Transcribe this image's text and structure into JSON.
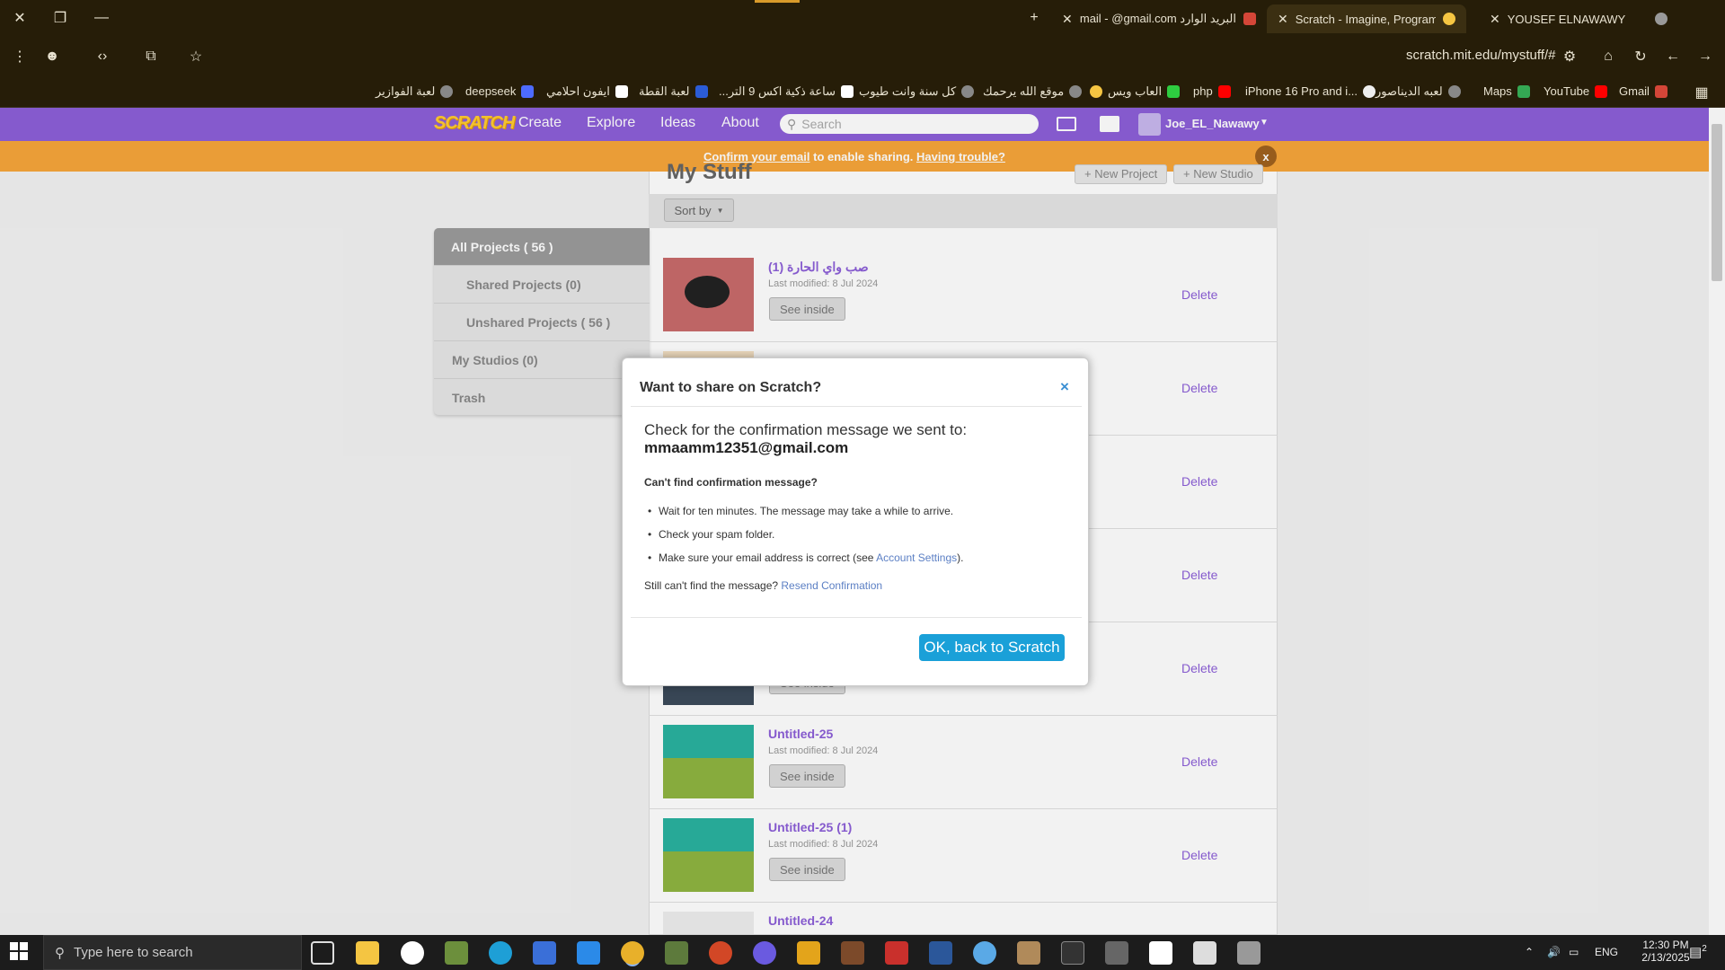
{
  "browser": {
    "tabs": [
      {
        "label": "البريد الوارد Gmail - @gmail.com",
        "favicon": "gmail-icon"
      },
      {
        "label": "Scratch - Imagine, Program, Sh",
        "favicon": "scratch-icon",
        "active": true
      },
      {
        "label": "YOUSEF ELNAWAWY",
        "favicon": "globe-icon"
      }
    ],
    "url": "scratch.mit.edu/mystuff/#",
    "bookmarks": [
      "Gmail",
      "YouTube",
      "Maps",
      "لعبه الديناصور",
      "iPhone 16 Pro and i...",
      "php",
      "العاب ويس",
      "موقع الله يرحمك",
      "كل سنة وانت طيوب",
      "ساعة ذكية اكس 9 التر...",
      "لعبة القطة",
      "ايفون احلامي",
      "deepseek",
      "لعبة الفوازير"
    ]
  },
  "scratch_nav": {
    "logo": "SCRATCH",
    "links": [
      "Create",
      "Explore",
      "Ideas",
      "About"
    ],
    "search_placeholder": "Search",
    "username": "Joe_EL_Nawawy"
  },
  "banner": {
    "link1": "Confirm your email",
    "middle": " to enable sharing. ",
    "link2": "Having trouble?",
    "close": "x"
  },
  "page": {
    "title": "My Stuff",
    "new_project": "+ New Project",
    "new_studio": "+ New Studio",
    "sort_by": "Sort by"
  },
  "sidebar": [
    {
      "label": "All Projects ( 56 )"
    },
    {
      "label": "Shared Projects (0)"
    },
    {
      "label": "Unshared Projects ( 56 )"
    },
    {
      "label": "My Studios (0)"
    },
    {
      "label": "Trash"
    }
  ],
  "projects": [
    {
      "title": "صب واي الحارة (1)",
      "modified": "Last modified: 8 Jul 2024",
      "see_inside": "See inside",
      "delete": "Delete"
    },
    {
      "title": "",
      "modified": "",
      "see_inside": "",
      "delete": "Delete"
    },
    {
      "title": "",
      "modified": "",
      "see_inside": "",
      "delete": "Delete"
    },
    {
      "title": "",
      "modified": "",
      "see_inside": "",
      "delete": "Delete"
    },
    {
      "title": "",
      "modified": "",
      "see_inside": "See inside",
      "delete": "Delete"
    },
    {
      "title": "Untitled-25",
      "modified": "Last modified: 8 Jul 2024",
      "see_inside": "See inside",
      "delete": "Delete"
    },
    {
      "title": "Untitled-25 (1)",
      "modified": "Last modified: 8 Jul 2024",
      "see_inside": "See inside",
      "delete": "Delete"
    },
    {
      "title": "Untitled-24",
      "modified": "",
      "see_inside": "",
      "delete": ""
    }
  ],
  "modal": {
    "title": "Want to share on Scratch?",
    "close": "×",
    "check_text": "Check for the confirmation message we sent to:",
    "email": "mmaamm12351@gmail.com",
    "cant_find": "Can't find confirmation message?",
    "bullet1": "Wait for ten minutes. The message may take a while to arrive.",
    "bullet2": "Check your spam folder.",
    "bullet3_pre": "Make sure your email address is correct (see ",
    "bullet3_link": "Account Settings",
    "bullet3_post": ").",
    "still_pre": "Still can't find the message? ",
    "still_link": "Resend Confirmation",
    "ok_button": "OK, back to Scratch"
  },
  "taskbar": {
    "search_placeholder": "Type here to search",
    "lang": "ENG",
    "time": "12:30 PM",
    "date": "2/13/2025",
    "notifications": "2"
  },
  "colors": {
    "scratch_purple": "#8d5fd9",
    "banner_orange": "#f7a63a",
    "ok_blue": "#1aa0d8",
    "chrome_bg": "#261d08"
  }
}
